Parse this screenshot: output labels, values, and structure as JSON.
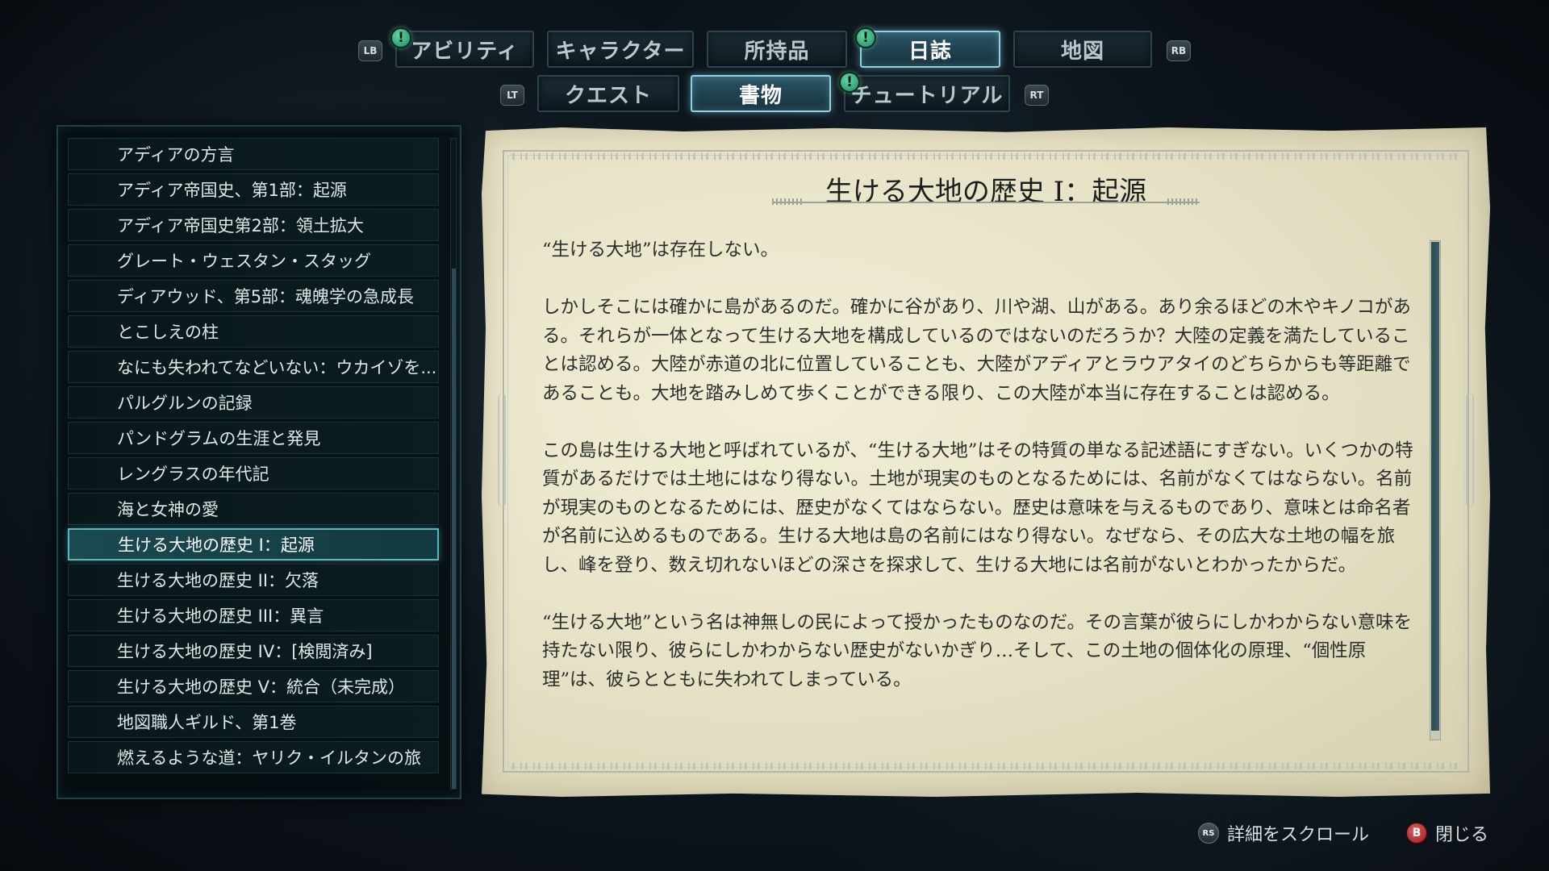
{
  "top_tabs": [
    {
      "label": "アビリティ",
      "badge": "!",
      "active": false
    },
    {
      "label": "キャラクター",
      "badge": "",
      "active": false
    },
    {
      "label": "所持品",
      "badge": "",
      "active": false
    },
    {
      "label": "日誌",
      "badge": "!",
      "active": true
    },
    {
      "label": "地図",
      "badge": "",
      "active": false
    }
  ],
  "top_hints": {
    "left": "LB",
    "right": "RB"
  },
  "sub_tabs": [
    {
      "label": "クエスト",
      "badge": "",
      "active": false
    },
    {
      "label": "書物",
      "badge": "",
      "active": true
    },
    {
      "label": "チュートリアル",
      "badge": "!",
      "active": false
    }
  ],
  "sub_hints": {
    "left": "LT",
    "right": "RT"
  },
  "books": [
    "アディアの方言",
    "アディア帝国史、第1部：起源",
    "アディア帝国史第2部：領土拡大",
    "グレート・ウェスタン・スタッグ",
    "ディアウッド、第5部：魂魄学の急成長",
    "とこしえの柱",
    "なにも失われてなどいない：ウカイゾを...",
    "パルグルンの記録",
    "パンドグラムの生涯と発見",
    "レングラスの年代記",
    "海と女神の愛",
    "生ける大地の歴史 I：起源",
    "生ける大地の歴史 II：欠落",
    "生ける大地の歴史 III：異言",
    "生ける大地の歴史 IV：[検閲済み]",
    "生ける大地の歴史 V：統合（未完成）",
    "地図職人ギルド、第1巻",
    "燃えるような道：ヤリク・イルタンの旅"
  ],
  "selected_book_index": 11,
  "list_scroll": {
    "thumb_start": 0.2,
    "thumb_fraction": 0.8
  },
  "document": {
    "title": "生ける大地の歴史 I：起源",
    "paragraphs": [
      "“生ける大地”は存在しない。",
      "しかしそこには確かに島があるのだ。確かに谷があり、川や湖、山がある。あり余るほどの木やキノコがある。それらが一体となって生ける大地を構成しているのではないのだろうか？大陸の定義を満たしていることは認める。大陸が赤道の北に位置していることも、大陸がアディアとラウアタイのどちらからも等距離であることも。大地を踏みしめて歩くことができる限り、この大陸が本当に存在することは認める。",
      "この島は生ける大地と呼ばれているが、“生ける大地”はその特質の単なる記述語にすぎない。いくつかの特質があるだけでは土地にはなり得ない。土地が現実のものとなるためには、名前がなくてはならない。名前が現実のものとなるためには、歴史がなくてはならない。歴史は意味を与えるものであり、意味とは命名者が名前に込めるものである。生ける大地は島の名前にはなり得ない。なぜなら、その広大な土地の幅を旅し、峰を登り、数え切れないほどの深さを探求して、生ける大地には名前がないとわかったからだ。",
      "“生ける大地”という名は神無しの民によって授かったものなのだ。その言葉が彼らにしかわからない意味を持たない限り、彼らにしかわからない歴史がないかぎり…そして、この土地の個体化の原理、“個性原理”は、彼らとともに失われてしまっている。"
    ],
    "scroll_fraction": 0.98
  },
  "footer": {
    "scroll": {
      "button": "RS",
      "label": "詳細をスクロール"
    },
    "close": {
      "button": "B",
      "label": "閉じる"
    }
  },
  "colors": {
    "accent": "#8ed2e4",
    "badge": "#3fbf88",
    "parchment": "#ebe6cc",
    "close_button": "#c23a3a"
  }
}
